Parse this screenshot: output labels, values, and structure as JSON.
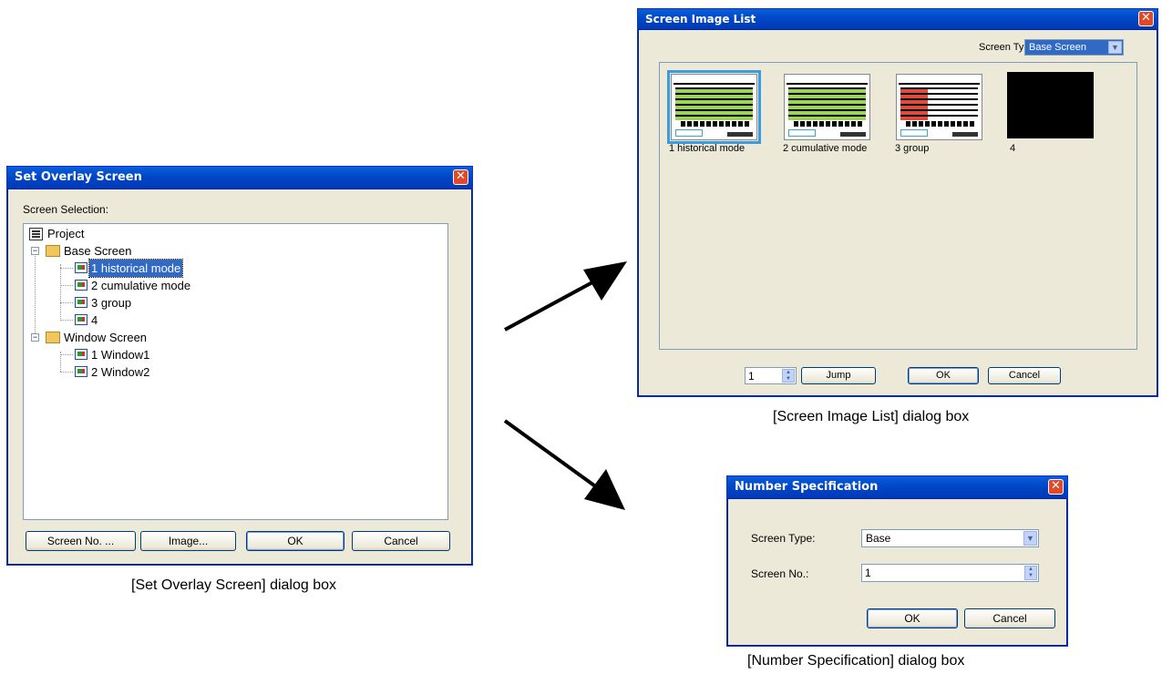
{
  "set_overlay": {
    "title": "Set Overlay Screen",
    "screen_selection_label": "Screen Selection:",
    "tree": [
      {
        "label": "Project"
      },
      {
        "label": "Base Screen"
      },
      {
        "label": "1 historical mode"
      },
      {
        "label": "2 cumulative mode"
      },
      {
        "label": "3 group"
      },
      {
        "label": "4"
      },
      {
        "label": "Window Screen"
      },
      {
        "label": "1 Window1"
      },
      {
        "label": "2 Window2"
      }
    ],
    "buttons": {
      "screen_no": "Screen No. ...",
      "image": "Image...",
      "ok": "OK",
      "cancel": "Cancel"
    },
    "caption": "[Set Overlay Screen] dialog box"
  },
  "screen_image_list": {
    "title": "Screen Image List",
    "screen_type_label": "Screen Type:",
    "screen_type_value": "Base Screen",
    "thumbnails": [
      {
        "label": "1 historical mode"
      },
      {
        "label": "2 cumulative mode"
      },
      {
        "label": "3 group"
      },
      {
        "label": "4"
      }
    ],
    "spin_value": "1",
    "buttons": {
      "jump": "Jump",
      "ok": "OK",
      "cancel": "Cancel"
    },
    "caption": "[Screen Image List] dialog box"
  },
  "number_spec": {
    "title": "Number Specification",
    "screen_type_label": "Screen Type:",
    "screen_type_value": "Base",
    "screen_no_label": "Screen No.:",
    "screen_no_value": "1",
    "buttons": {
      "ok": "OK",
      "cancel": "Cancel"
    },
    "caption": "[Number Specification] dialog box"
  },
  "colors": {
    "titlebar": "#0047c8",
    "dialog_bg": "#ece9d8",
    "selection": "#316ac5",
    "close_button": "#e2482a"
  }
}
